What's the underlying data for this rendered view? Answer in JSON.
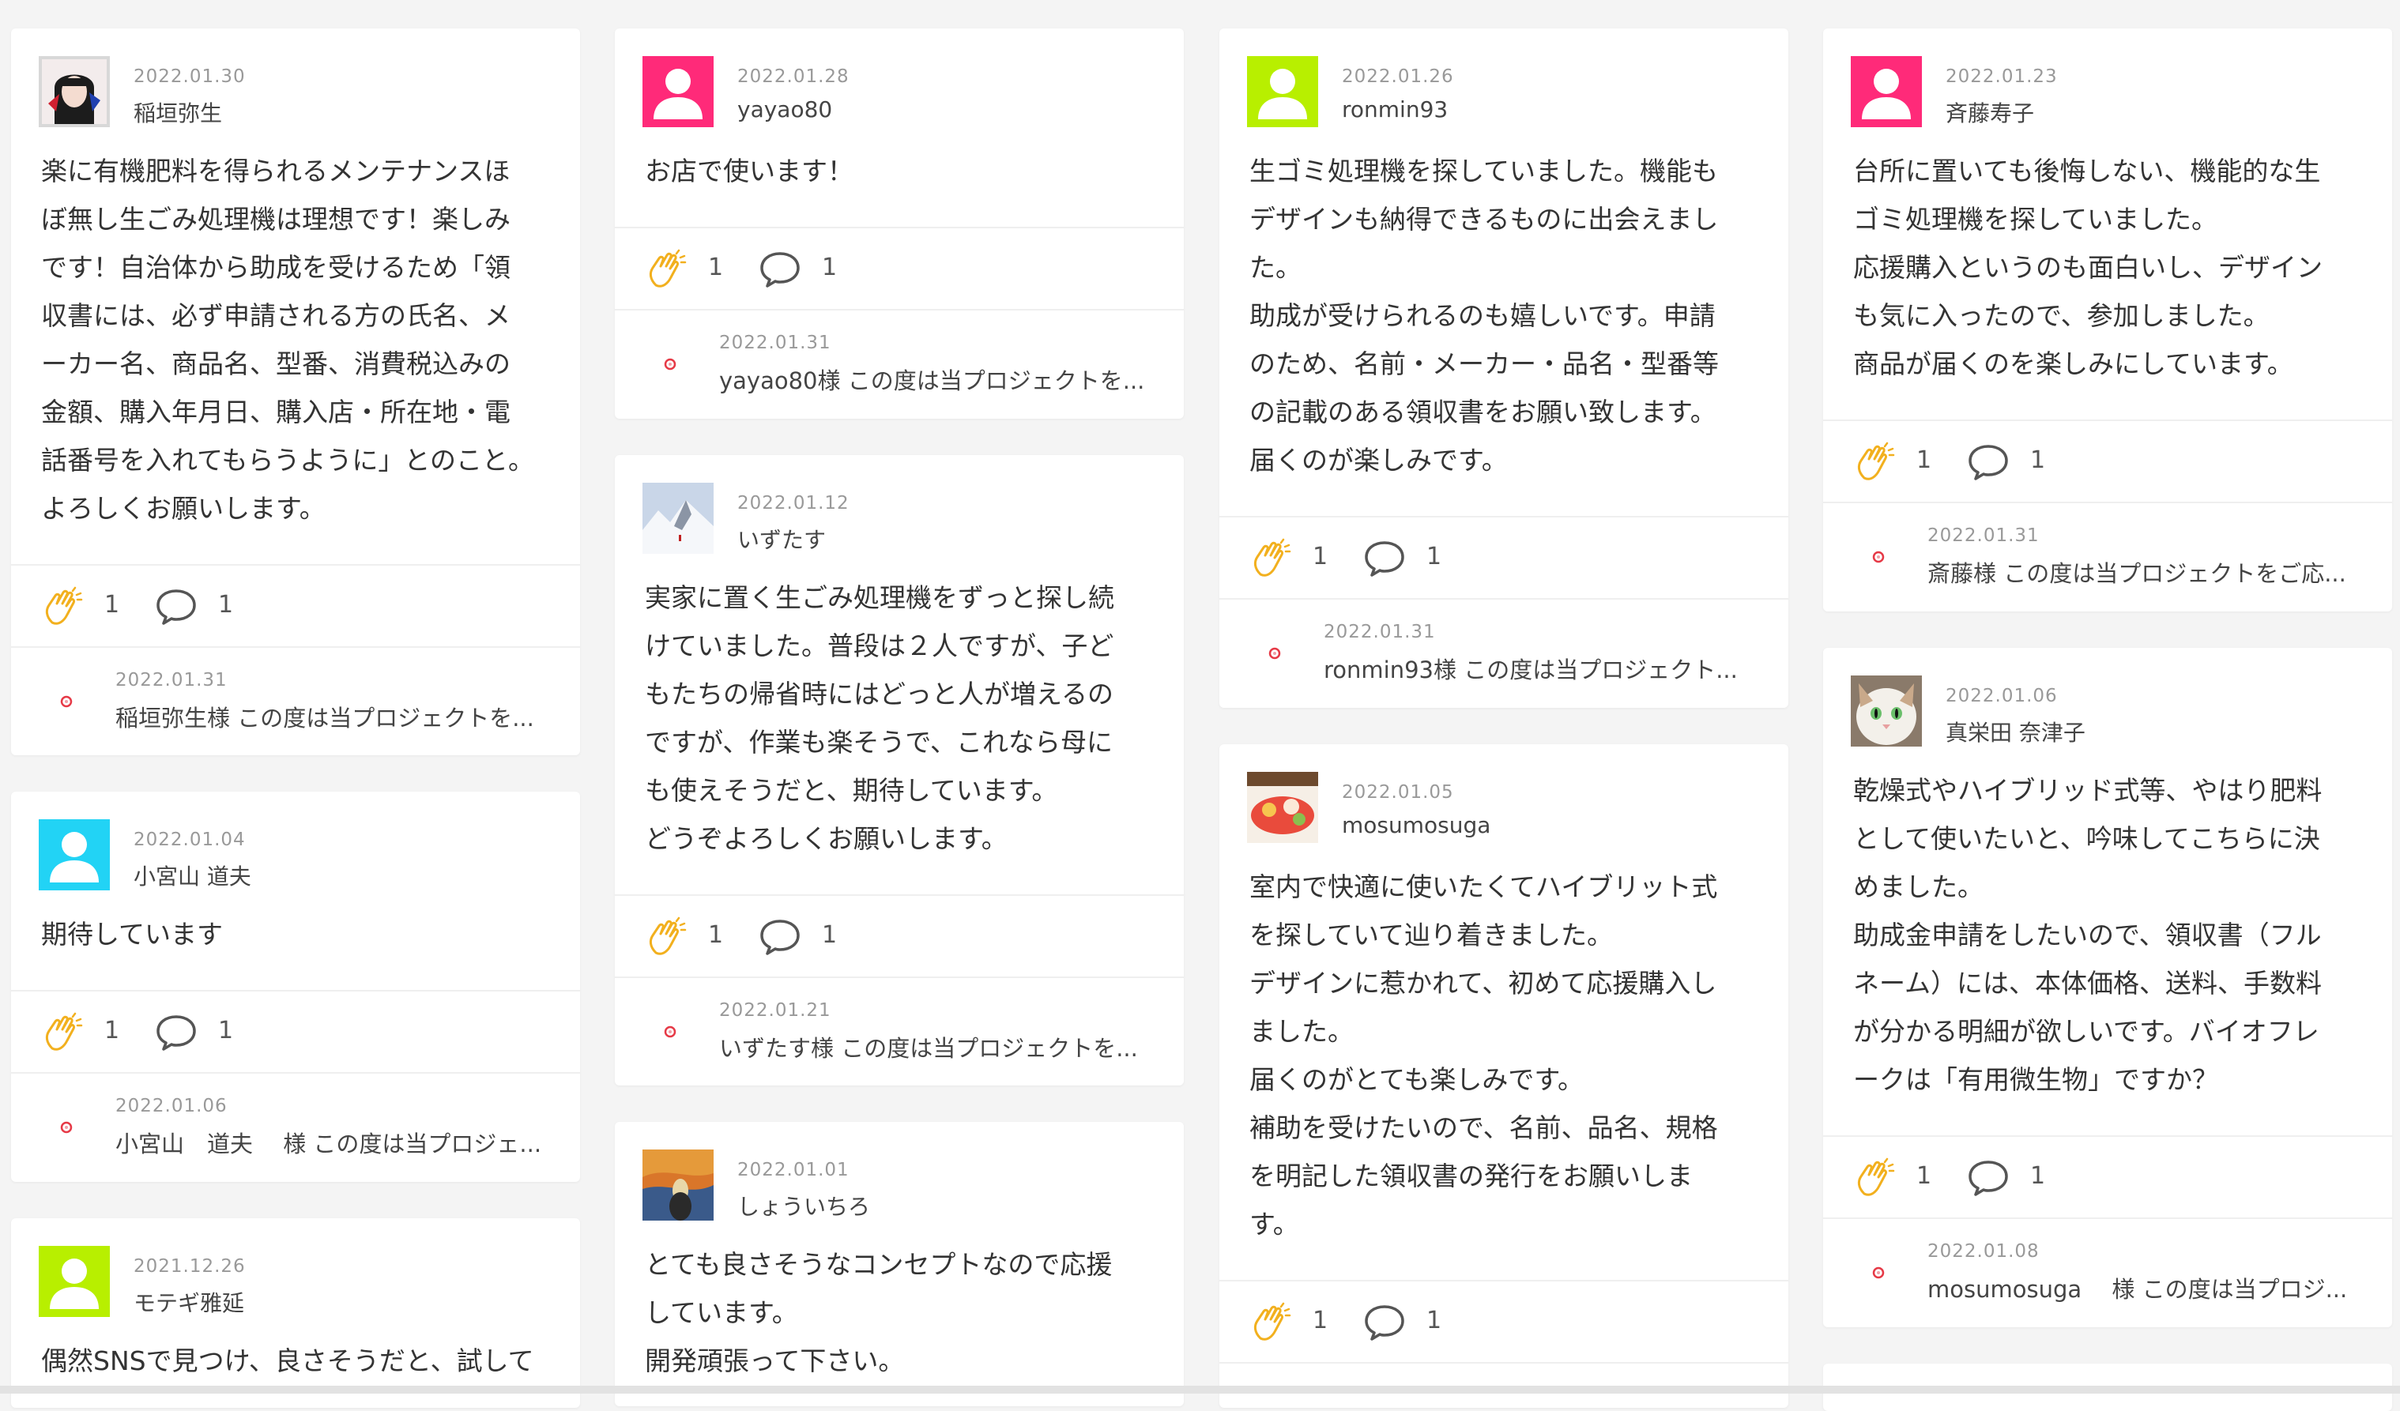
{
  "ui": {
    "icons": {
      "clap": "clapping-hands-icon",
      "comment": "speech-bubble-icon",
      "project_logo": "project-logo-icon"
    },
    "colors": {
      "accent_clap": "#f4b400",
      "avatar_pink": "#ff2a79",
      "avatar_lime": "#b8ef00",
      "avatar_cyan": "#22d3f5",
      "logo_red": "#e63946"
    }
  },
  "columns": [
    {
      "cards": [
        {
          "date": "2022.01.30",
          "user": "稲垣弥生",
          "body": "楽に有機肥料を得られるメンテナンスほ\nぼ無し生ごみ処理機は理想です！楽しみ\nです！自治体から助成を受けるため「領\n収書には、必ず申請される方の氏名、メ\nーカー名、商品名、型番、消費税込みの\n金額、購入年月日、購入店・所在地・電\n話番号を入れてもらうように」とのこと。\nよろしくお願いします。",
          "claps": "1",
          "comments": "1",
          "reply_date": "2022.01.31",
          "reply_text": "稲垣弥生様 この度は当プロジェクトを..."
        },
        {
          "date": "2022.01.04",
          "user": "小宮山 道夫",
          "body": "期待しています",
          "claps": "1",
          "comments": "1",
          "reply_date": "2022.01.06",
          "reply_text": "小宮山　道夫　 様 この度は当プロジェ..."
        },
        {
          "date": "2021.12.26",
          "user": "モテギ雅延",
          "body": "偶然SNSで見つけ、良さそうだと、試して"
        }
      ]
    },
    {
      "cards": [
        {
          "date": "2022.01.28",
          "user": "yayao80",
          "body": "お店で使います！",
          "claps": "1",
          "comments": "1",
          "reply_date": "2022.01.31",
          "reply_text": "yayao80様 この度は当プロジェクトを..."
        },
        {
          "date": "2022.01.12",
          "user": "いずたす",
          "body": "実家に置く生ごみ処理機をずっと探し続\nけていました。普段は２人ですが、子ど\nもたちの帰省時にはどっと人が増えるの\nですが、作業も楽そうで、これなら母に\nも使えそうだと、期待しています。\nどうぞよろしくお願いします。",
          "claps": "1",
          "comments": "1",
          "reply_date": "2022.01.21",
          "reply_text": "いずたす様 この度は当プロジェクトを..."
        },
        {
          "date": "2022.01.01",
          "user": "しょういちろ",
          "body": "とても良さそうなコンセプトなので応援\nしています。\n開発頑張って下さい。"
        }
      ]
    },
    {
      "cards": [
        {
          "date": "2022.01.26",
          "user": "ronmin93",
          "body": "生ゴミ処理機を探していました。機能も\nデザインも納得できるものに出会えまし\nた。\n助成が受けられるのも嬉しいです。申請\nのため、名前・メーカー・品名・型番等\nの記載のある領収書をお願い致します。\n届くのが楽しみです。",
          "claps": "1",
          "comments": "1",
          "reply_date": "2022.01.31",
          "reply_text": "ronmin93様 この度は当プロジェクト..."
        },
        {
          "date": "2022.01.05",
          "user": "mosumosuga",
          "body": "室内で快適に使いたくてハイブリット式\nを探していて辿り着きました。\nデザインに惹かれて、初めて応援購入し\nました。\n届くのがとても楽しみです。\n補助を受けたいので、名前、品名、規格\nを明記した領収書の発行をお願いしま\nす。",
          "claps": "1",
          "comments": "1"
        }
      ]
    },
    {
      "cards": [
        {
          "date": "2022.01.23",
          "user": "斉藤寿子",
          "body": "台所に置いても後悔しない、機能的な生\nゴミ処理機を探していました。\n応援購入というのも面白いし、デザイン\nも気に入ったので、参加しました。\n商品が届くのを楽しみにしています。",
          "claps": "1",
          "comments": "1",
          "reply_date": "2022.01.31",
          "reply_text": "斎藤様 この度は当プロジェクトをご応..."
        },
        {
          "date": "2022.01.06",
          "user": "真栄田 奈津子",
          "body": "乾燥式やハイブリッド式等、やはり肥料\nとして使いたいと、吟味してこちらに決\nめました。\n助成金申請をしたいので、領収書（フル\nネーム）には、本体価格、送料、手数料\nが分かる明細が欲しいです。バイオフレ\nークは「有用微生物」ですか？",
          "claps": "1",
          "comments": "1",
          "reply_date": "2022.01.08",
          "reply_text": "mosumosuga　 様 この度は当プロジ..."
        }
      ]
    }
  ]
}
